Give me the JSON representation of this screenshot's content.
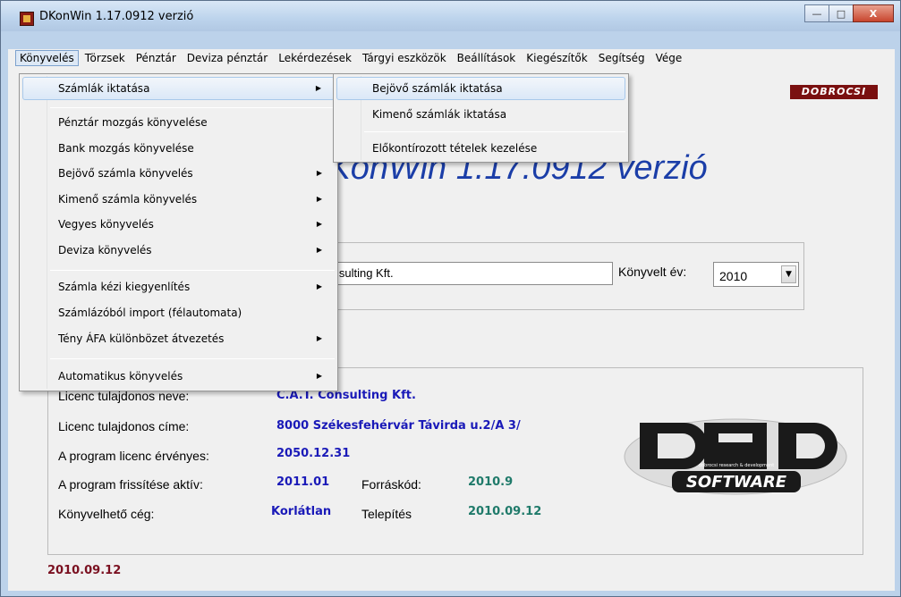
{
  "window": {
    "title": "DKonWin 1.17.0912 verzió"
  },
  "window_buttons": {
    "minimize": "—",
    "maximize": "□",
    "close": "X"
  },
  "menubar": {
    "items": [
      "Könyvelés",
      "Törzsek",
      "Pénztár",
      "Deviza pénztár",
      "Lekérdezések",
      "Tárgyi eszközök",
      "Beállítások",
      "Kiegészítők",
      "Segítség",
      "Vége"
    ]
  },
  "konyveles_menu": {
    "items": [
      {
        "label": "Számlák iktatása",
        "submenu": true
      },
      {
        "label": "Pénztár mozgás könyvelése",
        "submenu": false
      },
      {
        "label": "Bank mozgás könyvelése",
        "submenu": false
      },
      {
        "label": "Bejövő számla könyvelés",
        "submenu": true
      },
      {
        "label": "Kimenő számla könyvelés",
        "submenu": true
      },
      {
        "label": "Vegyes könyvelés",
        "submenu": true
      },
      {
        "label": "Deviza könyvelés",
        "submenu": true
      },
      {
        "label": "Számla kézi kiegyenlítés",
        "submenu": true
      },
      {
        "label": "Számlázóból import (félautomata)",
        "submenu": false
      },
      {
        "label": "Tény ÁFA különbözet átvezetés",
        "submenu": true
      },
      {
        "label": "Automatikus könyvelés",
        "submenu": true
      }
    ],
    "submenu_arrow": "▶"
  },
  "szamlak_submenu": {
    "items": [
      "Bejövő számlák iktatása",
      "Kimenő számlák iktatása",
      "Előkontírozott tételek kezelése"
    ]
  },
  "badge": "DOBROCSI",
  "big_title": "DKonWin 1.17.0912 verzió",
  "company": {
    "value": "C.A.T. Consulting Kft.",
    "year_label": "Könyvelt év:",
    "year_value": "2010",
    "year_arrow": "▼"
  },
  "license": {
    "owner_name_label": "Licenc tulajdonos neve:",
    "owner_name": "C.A.T. Consulting Kft.",
    "owner_address_label": "Licenc tulajdonos címe:",
    "owner_address": "8000 Székesfehérvár Távirda u.2/A 3/",
    "valid_label": "A program licenc érvényes:",
    "valid": "2050.12.31",
    "update_label": "A program frissítése aktív:",
    "update": "2011.01",
    "source_label": "Forráskód:",
    "source": "2010.9",
    "company_label": "Könyvelhető cég:",
    "company": "Korlátlan",
    "install_label": "Telepítés",
    "install": "2010.09.12"
  },
  "logo": {
    "text": "SOFTWARE",
    "sub": "dobrocsi research & development"
  },
  "footer_date": "2010.09.12"
}
